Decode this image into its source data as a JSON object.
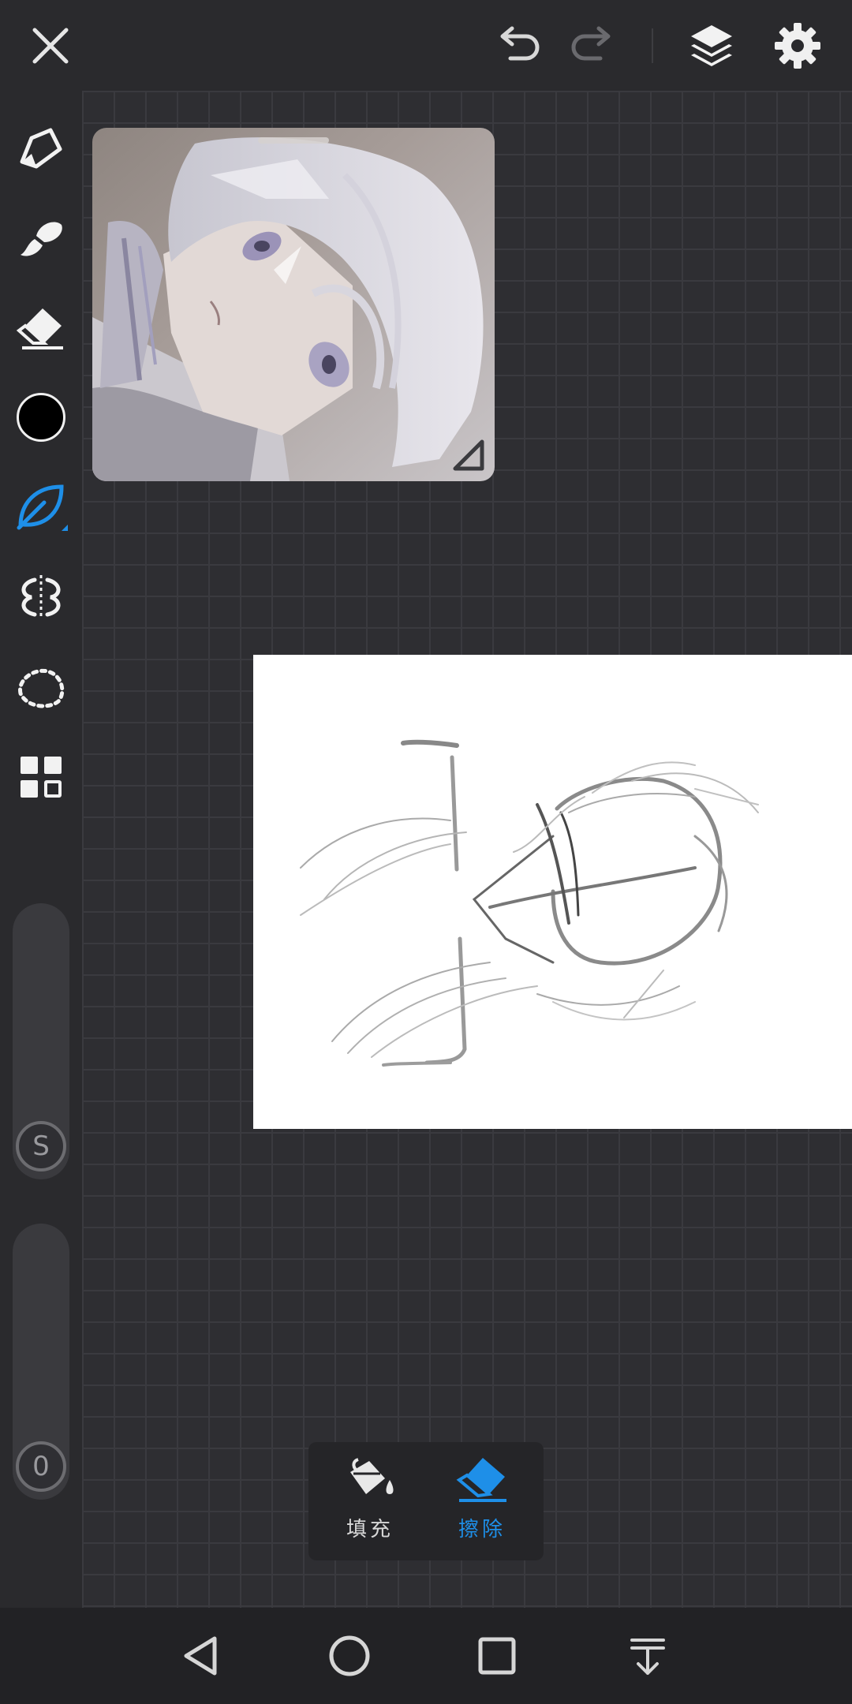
{
  "topbar": {
    "close_icon": "close-icon",
    "undo_icon": "undo-icon",
    "redo_icon": "redo-icon",
    "layers_icon": "layers-icon",
    "settings_icon": "gear-icon"
  },
  "toolbar": {
    "tools": [
      "pen-tool-icon",
      "smudge-brush-icon",
      "eraser-icon",
      "color-swatch",
      "leaf-brush-icon",
      "symmetry-icon",
      "lasso-icon",
      "grid-menu-icon"
    ],
    "current_color": "#000000",
    "accent_color": "#1e8fe8",
    "size_slider_label": "S",
    "opacity_slider_label": "0"
  },
  "popup": {
    "fill_label": "填充",
    "erase_label": "擦除"
  },
  "navbar": {
    "back": "back-icon",
    "home": "home-icon",
    "recents": "recents-icon",
    "menu": "dropdown-icon"
  }
}
